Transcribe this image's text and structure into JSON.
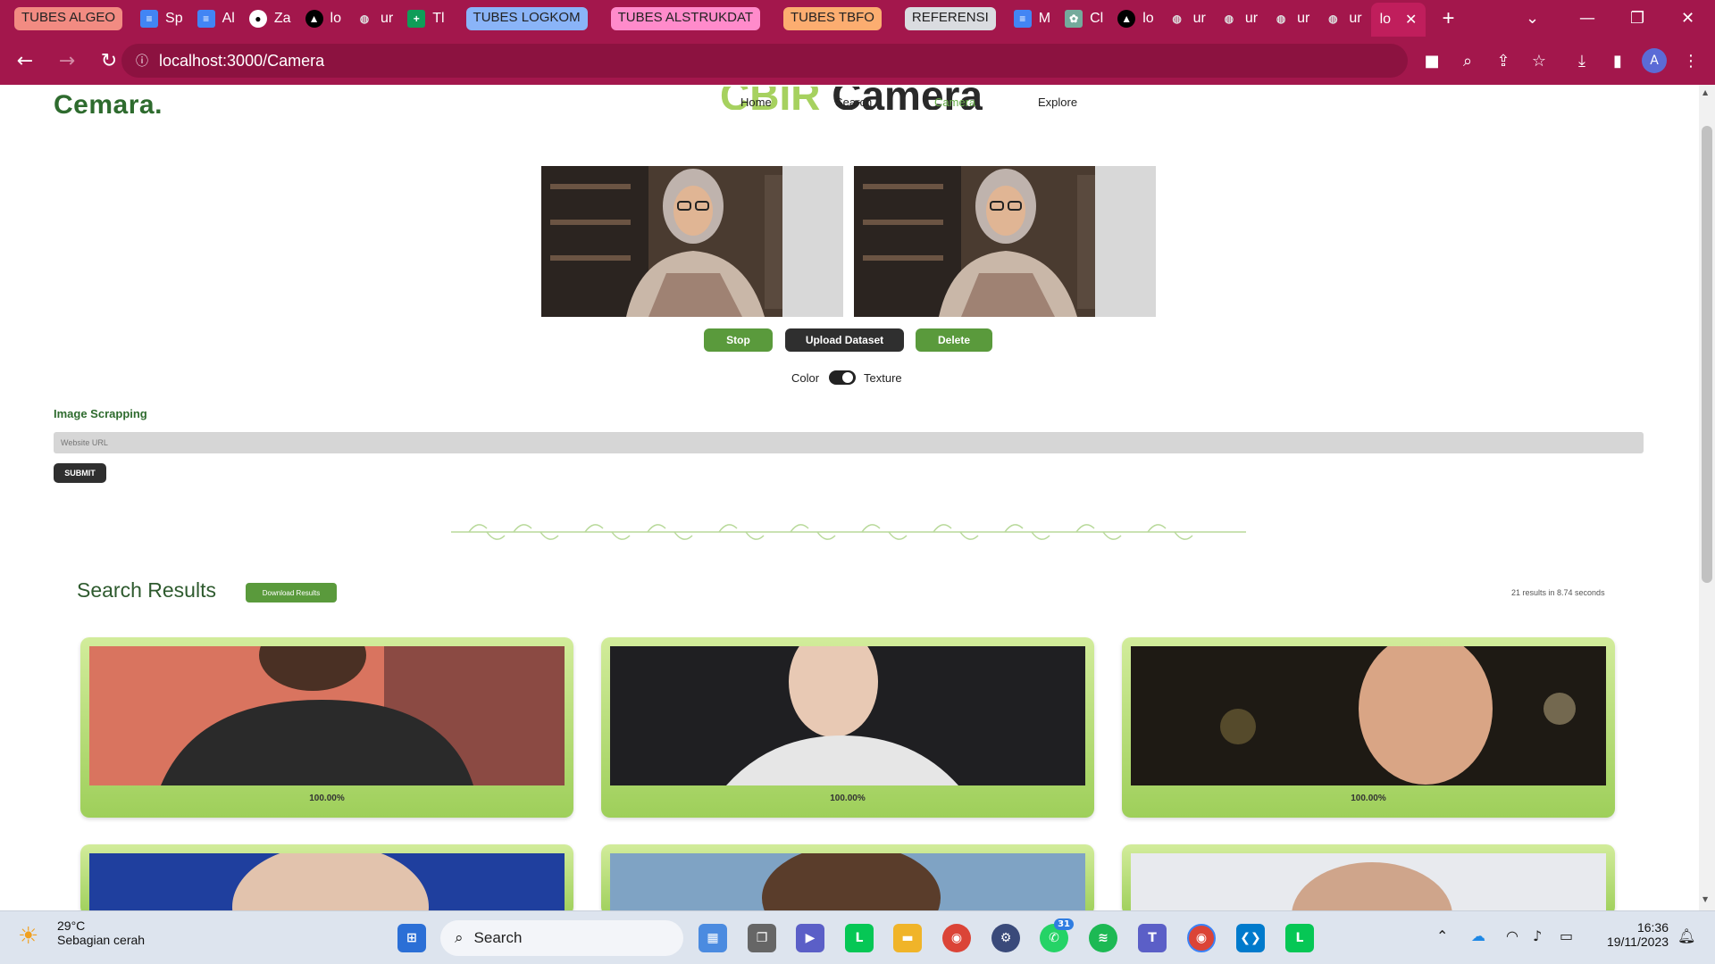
{
  "browser": {
    "tab_groups": [
      {
        "label": "TUBES ALGEO",
        "color": "#f28b82"
      },
      {
        "label": "TUBES LOGKOM",
        "color": "#8ab4f8"
      },
      {
        "label": "TUBES ALSTRUKDAT",
        "color": "#ff8bcb"
      },
      {
        "label": "TUBES TBFO",
        "color": "#fcad70"
      },
      {
        "label": "REFERENSI",
        "color": "#dadce0"
      }
    ],
    "tabs_a": [
      {
        "label": "Sp",
        "icon": "docs-icon"
      },
      {
        "label": "Al",
        "icon": "docs-icon"
      },
      {
        "label": "Za",
        "icon": "github-icon"
      },
      {
        "label": "lo",
        "icon": "vercel-icon"
      },
      {
        "label": "ur",
        "icon": "globe-icon"
      },
      {
        "label": "Tl",
        "icon": "sheets-icon"
      }
    ],
    "tabs_b": [
      {
        "label": "M",
        "icon": "docs-icon"
      },
      {
        "label": "Cl",
        "icon": "chatgpt-icon"
      },
      {
        "label": "lo",
        "icon": "vercel-icon"
      },
      {
        "label": "ur",
        "icon": "globe-icon"
      },
      {
        "label": "ur",
        "icon": "globe-icon"
      },
      {
        "label": "ur",
        "icon": "globe-icon"
      },
      {
        "label": "ur",
        "icon": "globe-icon"
      }
    ],
    "active_tab": "lo",
    "url": "localhost:3000/Camera",
    "accent": "#a3174c"
  },
  "site": {
    "logo": "Cemara.",
    "nav": [
      "Home",
      "Search",
      "Camera",
      "Explore"
    ],
    "title_a": "CBIR",
    "title_b": "Camera"
  },
  "controls": {
    "stop": "Stop",
    "upload": "Upload Dataset",
    "delete": "Delete",
    "toggle_left": "Color",
    "toggle_right": "Texture"
  },
  "scrape": {
    "heading": "Image Scrapping",
    "placeholder": "Website URL",
    "submit": "SUBMIT"
  },
  "results": {
    "title": "Search Results",
    "download": "Download Results",
    "meta": "21 results in 8.74 seconds",
    "cards": [
      {
        "similarity": "100.00%"
      },
      {
        "similarity": "100.00%"
      },
      {
        "similarity": "100.00%"
      }
    ]
  },
  "taskbar": {
    "temp": "29°C",
    "weather": "Sebagian cerah",
    "search": "Search",
    "time": "16:36",
    "date": "19/11/2023",
    "whatsapp_badge": "31"
  }
}
